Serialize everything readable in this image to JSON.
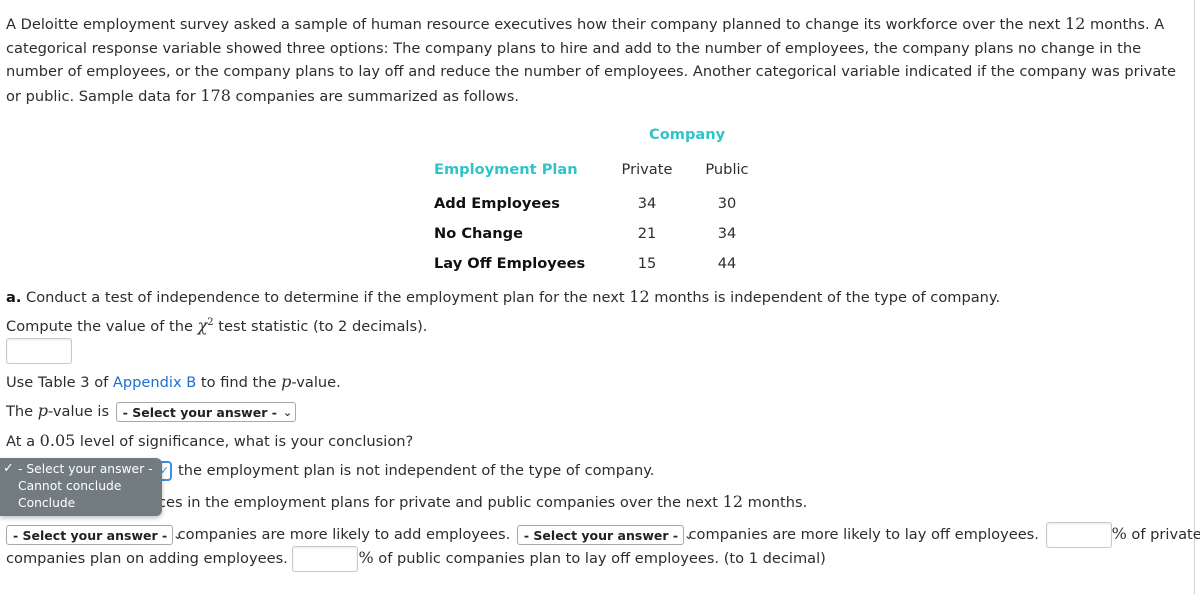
{
  "intro": {
    "p1": "A Deloitte employment survey asked a sample of human resource executives how their company planned to change its workforce over the next ",
    "n12": "12",
    "p2": " months. A categorical response variable showed three options: The company plans to hire and add to the number of employees, the company plans no change in the number of employees, or the company plans to lay off and reduce the number of employees. Another categorical variable indicated if the company was private or public. Sample data for ",
    "n178": "178",
    "p3": " companies are summarized as follows."
  },
  "table": {
    "group_header": "Company",
    "row_header": "Employment Plan",
    "columns": [
      "Private",
      "Public"
    ],
    "rows": [
      {
        "label": "Add Employees",
        "values": [
          "34",
          "30"
        ]
      },
      {
        "label": "No Change",
        "values": [
          "21",
          "34"
        ]
      },
      {
        "label": "Lay Off Employees",
        "values": [
          "15",
          "44"
        ]
      }
    ]
  },
  "part_a": {
    "label": "a.",
    "text1": " Conduct a test of independence to determine if the employment plan for the next ",
    "n12": "12",
    "text2": " months is independent of the type of company.",
    "compute1": "Compute the value of the ",
    "chi": "χ",
    "sup": "2",
    "compute2": " test statistic (to 2 decimals).",
    "chi_value": "",
    "use1": "Use Table 3 of ",
    "appendix_link": "Appendix B",
    "use2": " to find the ",
    "p": "p",
    "use3": "-value.",
    "pv1": "The ",
    "pv2": "-value is",
    "pvalue_select": "- Select your answer -",
    "sig1": "At a ",
    "alpha": "0.05",
    "sig2": " level of significance, what is your conclusion?",
    "conclusion_rest1": "the employment plan is not independent of the type of company.",
    "conclusion_rest2": "ces in the employment plans for private and public companies over the next ",
    "n12b": "12",
    "conclusion_rest3": " months."
  },
  "dropdown": {
    "options": [
      "- Select your answer -",
      "Cannot conclude",
      "Conclude"
    ],
    "selected_index": 0
  },
  "bottom": {
    "select1": "- Select your answer -",
    "text1": "companies are more likely to add employees.",
    "select2": "- Select your answer -",
    "text2": "companies are more likely to lay off employees.",
    "pct1_value": "",
    "pct_symbol": "%",
    "text3": " of private",
    "text4": "companies plan on adding employees.",
    "pct2_value": "",
    "text5": " of public companies plan to lay off employees. (to 1 decimal)"
  }
}
